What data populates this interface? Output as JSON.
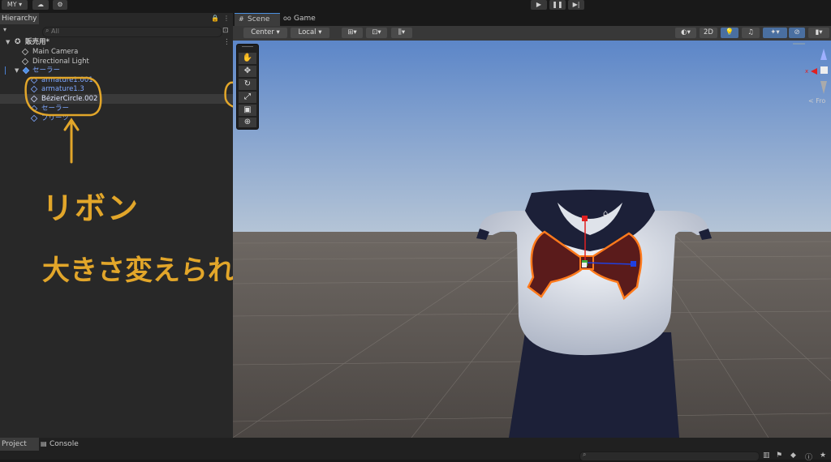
{
  "toolbar": {
    "account": "MY ▾",
    "play_icon": "play-icon",
    "pause_icon": "pause-icon",
    "step_icon": "step-icon"
  },
  "hierarchy": {
    "tab": "Hierarchy",
    "search_placeholder": "All",
    "scene_name": "販売用*",
    "items": [
      {
        "label": "Main Camera"
      },
      {
        "label": "Directional Light"
      },
      {
        "label": "セーラー"
      },
      {
        "label": "armature1.001"
      },
      {
        "label": "armature1.3"
      },
      {
        "label": "BézierCircle.002"
      },
      {
        "label": "セーラー"
      },
      {
        "label": "プリーツ"
      }
    ]
  },
  "scene": {
    "tabs": [
      {
        "label": "Scene"
      },
      {
        "label": "Game"
      }
    ],
    "pivot": "Center ▾",
    "space": "Local ▾",
    "mode_2d": "2D",
    "axis_label": "Fro"
  },
  "annotation": {
    "line1": "リボン",
    "line2": "大きさ変えられます"
  },
  "bottom": {
    "tabs": [
      {
        "label": "Project"
      },
      {
        "label": "Console"
      }
    ]
  },
  "colors": {
    "accent": "#e2a62a",
    "selection": "#3c5a7a",
    "panel": "#282828"
  }
}
